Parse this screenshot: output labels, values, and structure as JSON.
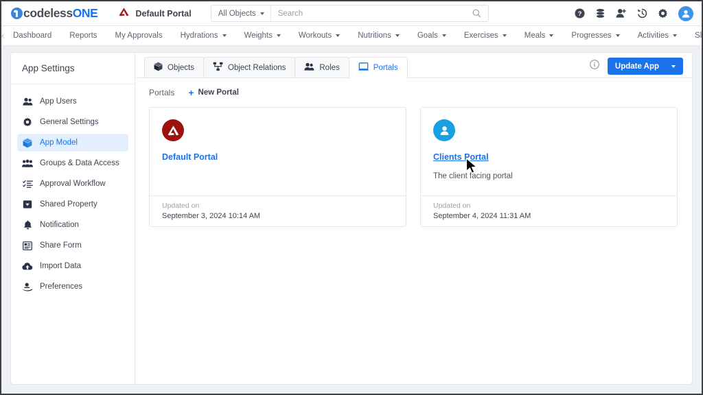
{
  "brand": {
    "name_part1": "codeless",
    "name_part2": "ONE",
    "accent": "#1a73e8"
  },
  "topbar": {
    "portal_name": "Default Portal",
    "search": {
      "scope": "All Objects",
      "value": "",
      "placeholder": "Search",
      "icon": "search-icon"
    },
    "icons": [
      {
        "name": "help-icon",
        "glyph": "?"
      },
      {
        "name": "database-icon",
        "glyph": ""
      },
      {
        "name": "add-user-icon",
        "glyph": ""
      },
      {
        "name": "history-icon",
        "glyph": ""
      },
      {
        "name": "gear-icon",
        "glyph": ""
      }
    ],
    "avatar": "user-avatar"
  },
  "nav": {
    "prev": "‹",
    "next": "›",
    "items": [
      {
        "label": "Dashboard",
        "dropdown": false
      },
      {
        "label": "Reports",
        "dropdown": false
      },
      {
        "label": "My Approvals",
        "dropdown": false
      },
      {
        "label": "Hydrations",
        "dropdown": true
      },
      {
        "label": "Weights",
        "dropdown": true
      },
      {
        "label": "Workouts",
        "dropdown": true
      },
      {
        "label": "Nutritions",
        "dropdown": true
      },
      {
        "label": "Goals",
        "dropdown": true
      },
      {
        "label": "Exercises",
        "dropdown": true
      },
      {
        "label": "Meals",
        "dropdown": true
      },
      {
        "label": "Progresses",
        "dropdown": true
      },
      {
        "label": "Activities",
        "dropdown": true
      },
      {
        "label": "Sleeps",
        "dropdown": false
      }
    ]
  },
  "sidebar": {
    "title": "App Settings",
    "items": [
      {
        "label": "App Users",
        "icon": "users-icon",
        "active": false
      },
      {
        "label": "General Settings",
        "icon": "gear-icon",
        "active": false
      },
      {
        "label": "App Model",
        "icon": "cube-icon",
        "active": true
      },
      {
        "label": "Groups & Data Access",
        "icon": "group-icon",
        "active": false
      },
      {
        "label": "Approval Workflow",
        "icon": "checklist-icon",
        "active": false
      },
      {
        "label": "Shared Property",
        "icon": "tag-icon",
        "active": false
      },
      {
        "label": "Notification",
        "icon": "bell-icon",
        "active": false
      },
      {
        "label": "Share Form",
        "icon": "form-icon",
        "active": false
      },
      {
        "label": "Import Data",
        "icon": "cloud-upload-icon",
        "active": false
      },
      {
        "label": "Preferences",
        "icon": "preferences-icon",
        "active": false
      }
    ]
  },
  "content": {
    "tabs": [
      {
        "label": "Objects",
        "icon": "cube-icon",
        "active": false
      },
      {
        "label": "Object Relations",
        "icon": "relations-icon",
        "active": false
      },
      {
        "label": "Roles",
        "icon": "roles-icon",
        "active": false
      },
      {
        "label": "Portals",
        "icon": "portal-icon",
        "active": true
      }
    ],
    "info_icon": "info-icon",
    "update_button": "Update App",
    "breadcrumb": "Portals",
    "new_portal": "New Portal",
    "cards": [
      {
        "title": "Default Portal",
        "description": "",
        "avatar_color": "#9d1111",
        "avatar_icon": "codeless-mark-icon",
        "updated_label": "Updated on",
        "updated_value": "September 3, 2024 10:14 AM",
        "hovered": false
      },
      {
        "title": "Clients Portal",
        "description": "The client facing portal",
        "avatar_color": "#18a0e0",
        "avatar_icon": "person-icon",
        "updated_label": "Updated on",
        "updated_value": "September 4, 2024 11:31 AM",
        "hovered": true
      }
    ]
  }
}
